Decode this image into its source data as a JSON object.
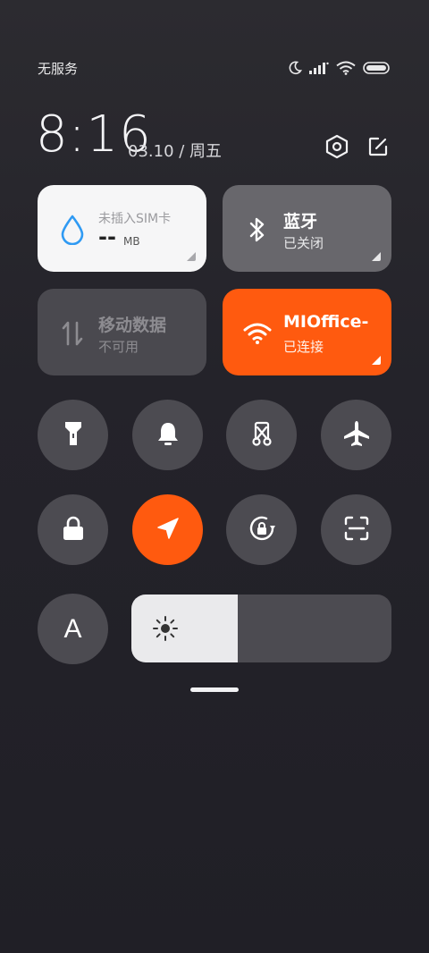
{
  "status_bar": {
    "carrier": "无服务",
    "icons": [
      "moon-icon",
      "signal-icon",
      "wifi-icon",
      "battery-icon"
    ]
  },
  "header": {
    "time": "8:16",
    "date": "03.10 / 周五",
    "settings_icon": "settings-hex-icon",
    "edit_icon": "edit-icon"
  },
  "tiles": {
    "data_usage": {
      "title": "未插入SIM卡",
      "value": "--",
      "unit": "MB",
      "icon": "water-drop-icon"
    },
    "bluetooth": {
      "title": "蓝牙",
      "status": "已关闭",
      "icon": "bluetooth-icon"
    },
    "mobile_data": {
      "title": "移动数据",
      "status": "不可用",
      "icon": "mobile-data-arrows-icon"
    },
    "wifi": {
      "title": "MIOffice-",
      "status": "已连接",
      "icon": "wifi-icon"
    }
  },
  "toggles": [
    {
      "name": "flashlight",
      "icon": "flashlight-icon",
      "active": false
    },
    {
      "name": "ringer",
      "icon": "bell-icon",
      "active": false
    },
    {
      "name": "screenshot",
      "icon": "scissors-icon",
      "active": false
    },
    {
      "name": "airplane-mode",
      "icon": "airplane-icon",
      "active": false
    },
    {
      "name": "lock-screen",
      "icon": "lock-icon",
      "active": false
    },
    {
      "name": "location",
      "icon": "location-arrow-icon",
      "active": true
    },
    {
      "name": "rotation-lock",
      "icon": "rotation-lock-icon",
      "active": false
    },
    {
      "name": "scanner",
      "icon": "scan-icon",
      "active": false
    }
  ],
  "auto_brightness": {
    "label": "A"
  },
  "brightness": {
    "level": 0.41,
    "icon": "sun-icon"
  },
  "colors": {
    "accent": "#ff5a0f",
    "tile_inactive": "#68676c",
    "tile_disabled": "#4a494f",
    "tile_light": "#f6f6f7",
    "data_blue": "#2f9af3"
  }
}
